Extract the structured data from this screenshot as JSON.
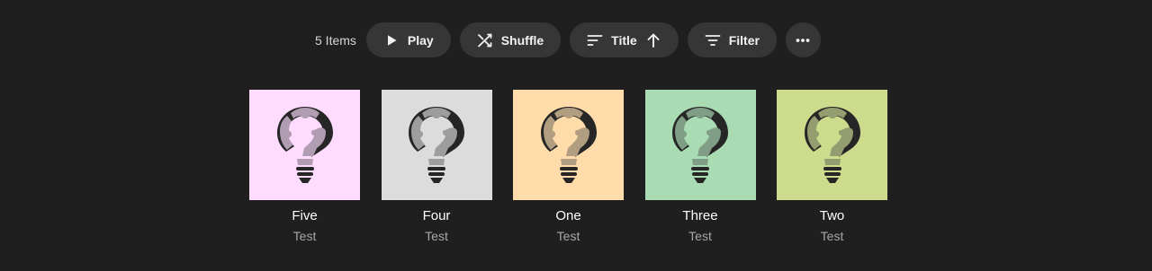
{
  "toolbar": {
    "item_count": "5 Items",
    "play_label": "Play",
    "shuffle_label": "Shuffle",
    "sort_label": "Title",
    "filter_label": "Filter",
    "icons": {
      "play": "play-icon",
      "shuffle": "shuffle-icon",
      "sort": "sort-lines-icon",
      "sort_direction": "arrow-up-icon",
      "filter": "filter-icon",
      "more": "more-dots-icon"
    }
  },
  "albums": [
    {
      "title": "Five",
      "artist": "Test",
      "cover_color": "#ffdcff",
      "icon": "lightbulb-question-icon"
    },
    {
      "title": "Four",
      "artist": "Test",
      "cover_color": "#dcdcdc",
      "icon": "lightbulb-question-icon"
    },
    {
      "title": "One",
      "artist": "Test",
      "cover_color": "#ffdcaa",
      "icon": "lightbulb-question-icon"
    },
    {
      "title": "Three",
      "artist": "Test",
      "cover_color": "#aadcb4",
      "icon": "lightbulb-question-icon"
    },
    {
      "title": "Two",
      "artist": "Test",
      "cover_color": "#cddc8c",
      "icon": "lightbulb-question-icon"
    }
  ],
  "colors": {
    "background": "#1f1f1f",
    "pill": "#363636",
    "bulb_dark": "#262626"
  }
}
